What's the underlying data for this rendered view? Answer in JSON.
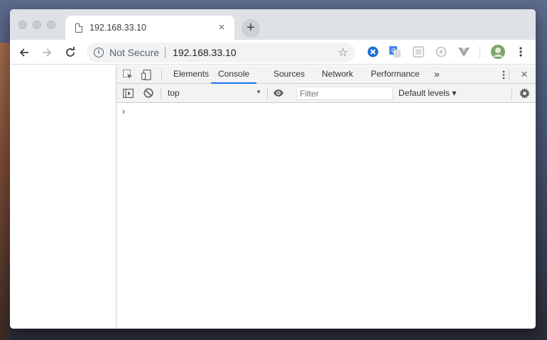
{
  "browser": {
    "tab": {
      "title": "192.168.33.10",
      "close_label": "×"
    },
    "new_tab_label": "+",
    "omnibox": {
      "security_label": "Not Secure",
      "url": "192.168.33.10"
    }
  },
  "devtools": {
    "tabs": [
      "Elements",
      "Console",
      "Sources",
      "Network",
      "Performance"
    ],
    "active_tab": "Console",
    "more_tabs_label": "»",
    "close_label": "×",
    "console": {
      "context": "top",
      "filter_placeholder": "Filter",
      "levels_label": "Default levels ▾",
      "prompt_symbol": "›"
    }
  },
  "colors": {
    "accent": "#1a73e8",
    "tabstrip": "#dee1e6",
    "devtools_bar": "#f3f3f3"
  }
}
